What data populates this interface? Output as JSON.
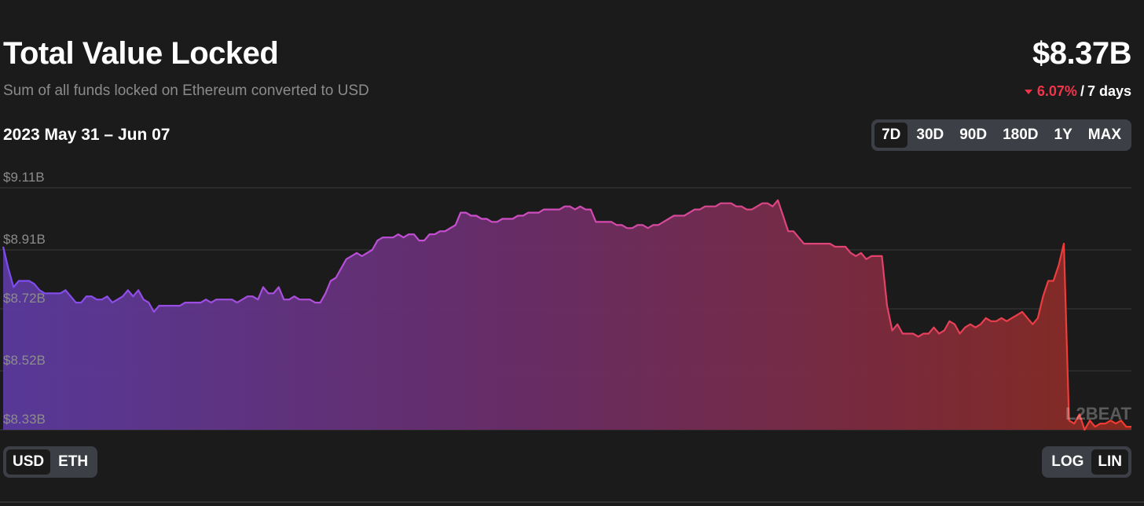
{
  "header": {
    "title": "Total Value Locked",
    "subtitle": "Sum of all funds locked on Ethereum converted to USD",
    "value": "$8.37B",
    "change_pct": "6.07%",
    "change_sep": "/",
    "change_period": "7 days",
    "change_color": "#f2344b"
  },
  "date_range": "2023 May 31 – Jun 07",
  "range_buttons": [
    {
      "label": "7D",
      "active": true
    },
    {
      "label": "30D",
      "active": false
    },
    {
      "label": "90D",
      "active": false
    },
    {
      "label": "180D",
      "active": false
    },
    {
      "label": "1Y",
      "active": false
    },
    {
      "label": "MAX",
      "active": false
    }
  ],
  "currency_buttons": [
    {
      "label": "USD",
      "active": true
    },
    {
      "label": "ETH",
      "active": false
    }
  ],
  "scale_buttons": [
    {
      "label": "LOG",
      "active": false
    },
    {
      "label": "LIN",
      "active": true
    }
  ],
  "watermark": "L2BEAT",
  "colors": {
    "background": "#1b1b1b",
    "gradient_start": "#7b4cf0",
    "gradient_mid": "#c94fd0",
    "gradient_end": "#f23a2b"
  },
  "chart_data": {
    "type": "area",
    "title": "Total Value Locked",
    "xlabel": "",
    "ylabel": "",
    "x_range": [
      "2023-05-31",
      "2023-06-07"
    ],
    "ylim": [
      8.33,
      9.11
    ],
    "yticks": [
      "$9.11B",
      "$8.91B",
      "$8.72B",
      "$8.52B",
      "$8.33B"
    ],
    "ytick_values": [
      9.11,
      8.91,
      8.72,
      8.52,
      8.33
    ],
    "grid": true,
    "units": "USD billions",
    "series": [
      {
        "values": [
          8.92,
          8.85,
          8.79,
          8.81,
          8.81,
          8.81,
          8.8,
          8.78,
          8.77,
          8.77,
          8.77,
          8.77,
          8.78,
          8.76,
          8.74,
          8.74,
          8.76,
          8.76,
          8.75,
          8.75,
          8.76,
          8.74,
          8.75,
          8.76,
          8.78,
          8.76,
          8.78,
          8.75,
          8.74,
          8.71,
          8.73,
          8.73,
          8.73,
          8.73,
          8.73,
          8.74,
          8.74,
          8.74,
          8.74,
          8.75,
          8.74,
          8.75,
          8.75,
          8.75,
          8.75,
          8.74,
          8.75,
          8.76,
          8.76,
          8.75,
          8.79,
          8.77,
          8.77,
          8.79,
          8.75,
          8.75,
          8.76,
          8.75,
          8.75,
          8.75,
          8.74,
          8.74,
          8.77,
          8.81,
          8.82,
          8.85,
          8.88,
          8.89,
          8.9,
          8.89,
          8.9,
          8.91,
          8.94,
          8.95,
          8.95,
          8.95,
          8.96,
          8.95,
          8.96,
          8.96,
          8.94,
          8.94,
          8.96,
          8.96,
          8.97,
          8.97,
          8.98,
          8.99,
          9.03,
          9.03,
          9.02,
          9.02,
          9.01,
          9.01,
          9.0,
          9.0,
          9.01,
          9.01,
          9.01,
          9.02,
          9.02,
          9.03,
          9.03,
          9.03,
          9.04,
          9.04,
          9.04,
          9.04,
          9.05,
          9.05,
          9.04,
          9.05,
          9.04,
          9.04,
          9.0,
          9.0,
          9.0,
          9.0,
          8.99,
          8.99,
          8.98,
          8.98,
          8.99,
          8.99,
          8.98,
          8.99,
          8.99,
          9.0,
          9.01,
          9.02,
          9.02,
          9.02,
          9.03,
          9.04,
          9.04,
          9.05,
          9.05,
          9.05,
          9.06,
          9.06,
          9.06,
          9.05,
          9.05,
          9.04,
          9.04,
          9.05,
          9.06,
          9.06,
          9.05,
          9.07,
          9.02,
          8.97,
          8.97,
          8.95,
          8.93,
          8.93,
          8.93,
          8.93,
          8.93,
          8.93,
          8.92,
          8.92,
          8.92,
          8.9,
          8.89,
          8.9,
          8.88,
          8.89,
          8.89,
          8.89,
          8.73,
          8.65,
          8.67,
          8.64,
          8.64,
          8.64,
          8.63,
          8.64,
          8.64,
          8.66,
          8.64,
          8.65,
          8.68,
          8.67,
          8.64,
          8.66,
          8.67,
          8.66,
          8.67,
          8.69,
          8.68,
          8.68,
          8.69,
          8.68,
          8.69,
          8.7,
          8.71,
          8.69,
          8.67,
          8.69,
          8.76,
          8.81,
          8.81,
          8.86,
          8.93,
          8.36,
          8.35,
          8.38,
          8.33,
          8.36,
          8.34,
          8.35,
          8.35,
          8.36,
          8.35,
          8.36,
          8.34,
          8.34
        ]
      }
    ]
  }
}
